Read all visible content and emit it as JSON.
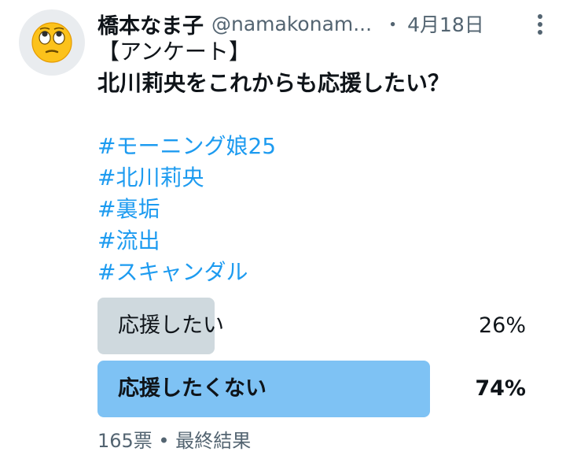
{
  "tweet": {
    "author_name": "橋本なま子",
    "author_handle": "@namakonam...",
    "separator": "・",
    "date": "4月18日",
    "avatar_icon": "face-with-rolling-eyes-icon",
    "more_icon": "more-vertical-icon",
    "lines": [
      "【アンケート】",
      "北川莉央をこれからも応援したい？"
    ],
    "hashtags": [
      "#モーニング娘25",
      "#北川莉央",
      "#裏垢",
      "#流出",
      "#スキャンダル"
    ]
  },
  "poll": {
    "options": [
      {
        "label": "応援したい",
        "percent_label": "26%",
        "percent": 26,
        "winner": false
      },
      {
        "label": "応援したくない",
        "percent_label": "74%",
        "percent": 74,
        "winner": true
      }
    ],
    "footer": "165票 • 最終結果",
    "colors": {
      "winner_bar": "#7ec2f4",
      "loser_bar": "#cfd9de",
      "hashtag": "#1d9bf0"
    }
  }
}
